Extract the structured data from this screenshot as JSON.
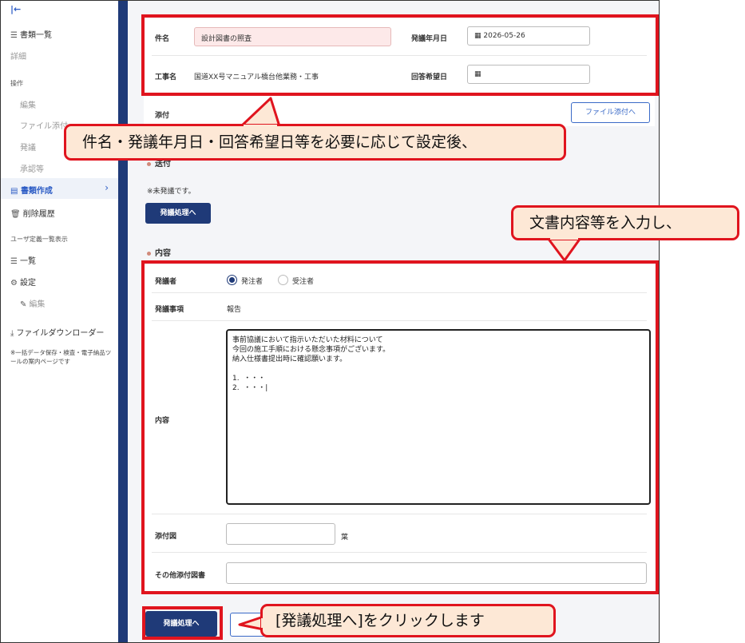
{
  "sidebar": {
    "collapse_icon": "collapse-left-icon",
    "items": [
      {
        "label": "書類一覧"
      },
      {
        "label": "詳細"
      },
      {
        "label": "操作"
      },
      {
        "label": "編集"
      },
      {
        "label": "ファイル添付"
      },
      {
        "label": "発議"
      },
      {
        "label": "承認等"
      },
      {
        "label": "書類作成"
      },
      {
        "label": "削除履歴"
      },
      {
        "label": "ユーザ定義一覧表示"
      },
      {
        "label": "一覧"
      },
      {
        "label": "設定"
      },
      {
        "label": "編集"
      },
      {
        "label": "ファイルダウンローダー"
      }
    ],
    "note": "※一括データ保存・検査・電子納品ツールの案内ページです"
  },
  "form": {
    "subject_label": "件名",
    "subject_value": "設計図書の照査",
    "issue_date_label": "発議年月日",
    "issue_date_value": "2026-05-26",
    "project_label": "工事名",
    "project_value": "国道XX号マニュアル橋台他業務・工事",
    "reply_date_label": "回答希望日",
    "reply_date_value": "",
    "attach_label": "添付",
    "attach_button": "ファイル添付へ"
  },
  "send_section": {
    "title": "送付",
    "status": "※未発議です。",
    "button": "発議処理へ"
  },
  "content_section": {
    "title": "内容",
    "initiator_label": "発議者",
    "initiator_options": [
      "発注者",
      "受注者"
    ],
    "initiator_selected": 0,
    "item_label": "発議事項",
    "item_value": "報告",
    "body_label": "内容",
    "body_value": "事前協議において指示いただいた材料について\n今回の施工手順における懸念事項がございます。\n納入仕様書提出時に確認願います。\n\n1.  ・・・\n2.  ・・・|",
    "drawings_label": "添付図",
    "drawings_value": "",
    "drawings_unit": "葉",
    "other_drawings_label": "その他添付図書",
    "other_drawings_value": ""
  },
  "footer": {
    "submit_button": "発議処理へ",
    "second_button_fragment": "保"
  },
  "callouts": {
    "top": "件名・発議年月日・回答希望日等を必要に応じて設定後、",
    "middle": "文書内容等を入力し、",
    "bottom": "[発議処理へ]をクリックします"
  },
  "colors": {
    "annotation_red": "#e0141e",
    "callout_fill": "#fde8d6",
    "navy": "#1f3a78",
    "accent_blue": "#2c5cc5"
  }
}
